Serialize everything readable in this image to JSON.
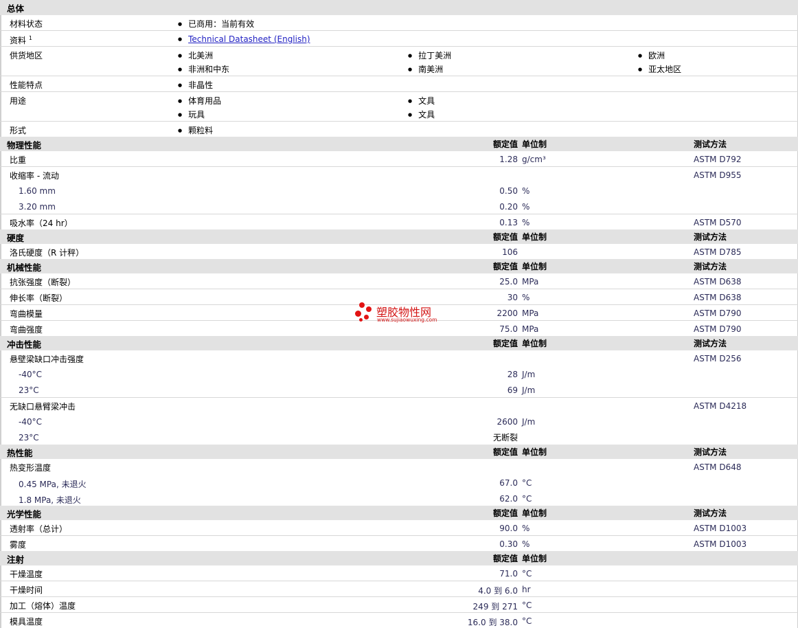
{
  "general": {
    "title": "总体",
    "status_label": "材料状态",
    "status_value": "已商用：当前有效",
    "docs_label": "资料",
    "docs_sup": "1",
    "docs_link": "Technical Datasheet (English)",
    "regions_label": "供货地区",
    "regions": [
      "北美洲",
      "拉丁美洲",
      "欧洲",
      "非洲和中东",
      "南美洲",
      "亚太地区"
    ],
    "features_label": "性能特点",
    "features": [
      "非晶性"
    ],
    "uses_label": "用途",
    "uses": [
      "体育用品",
      "文具",
      "玩具",
      "文具"
    ],
    "form_label": "形式",
    "forms": [
      "颗粒料"
    ]
  },
  "headers": {
    "nominal": "额定值",
    "unit": "单位制",
    "test": "测试方法"
  },
  "physical": {
    "title": "物理性能",
    "sg_label": "比重",
    "sg_value": "1.28",
    "sg_unit": "g/cm³",
    "sg_test": "ASTM D792",
    "shrink_label": "收缩率  - 流动",
    "shrink_test": "ASTM D955",
    "shrink1_label": "1.60 mm",
    "shrink1_value": "0.50",
    "shrink1_unit": "%",
    "shrink2_label": "3.20 mm",
    "shrink2_value": "0.20",
    "shrink2_unit": "%",
    "water_label": "吸水率（24 hr）",
    "water_value": "0.13",
    "water_unit": "%",
    "water_test": "ASTM D570"
  },
  "hardness": {
    "title": "硬度",
    "rockwell_label": "洛氏硬度（R 计秤）",
    "rockwell_value": "106",
    "rockwell_test": "ASTM D785"
  },
  "mechanical": {
    "title": "机械性能",
    "tensile_label": "抗张强度（断裂）",
    "tensile_value": "25.0",
    "tensile_unit": "MPa",
    "tensile_test": "ASTM D638",
    "elong_label": "伸长率（断裂）",
    "elong_value": "30",
    "elong_unit": "%",
    "elong_test": "ASTM D638",
    "flexmod_label": "弯曲模量",
    "flexmod_value": "2200",
    "flexmod_unit": "MPa",
    "flexmod_test": "ASTM D790",
    "flexstr_label": "弯曲强度",
    "flexstr_value": "75.0",
    "flexstr_unit": "MPa",
    "flexstr_test": "ASTM D790"
  },
  "impact": {
    "title": "冲击性能",
    "izod_label": "悬壁梁缺口冲击强度",
    "izod_test": "ASTM D256",
    "izod1_label": "-40°C",
    "izod1_value": "28",
    "izod1_unit": "J/m",
    "izod2_label": "23°C",
    "izod2_value": "69",
    "izod2_unit": "J/m",
    "unnotched_label": "无缺口悬臂梁冲击",
    "unnotched_test": "ASTM D4218",
    "un1_label": "-40°C",
    "un1_value": "2600",
    "un1_unit": "J/m",
    "un2_label": "23°C",
    "un2_value": "无断裂"
  },
  "thermal": {
    "title": "热性能",
    "hdt_label": "热变形温度",
    "hdt_test": "ASTM D648",
    "hdt1_label": "0.45 MPa, 未退火",
    "hdt1_value": "67.0",
    "hdt1_unit": "°C",
    "hdt2_label": "1.8 MPa, 未退火",
    "hdt2_value": "62.0",
    "hdt2_unit": "°C"
  },
  "optical": {
    "title": "光学性能",
    "trans_label": "透射率（总计）",
    "trans_value": "90.0",
    "trans_unit": "%",
    "trans_test": "ASTM D1003",
    "haze_label": "雾度",
    "haze_value": "0.30",
    "haze_unit": "%",
    "haze_test": "ASTM D1003"
  },
  "injection": {
    "title": "注射",
    "dry_temp_label": "干燥温度",
    "dry_temp_value": "71.0",
    "dry_temp_unit": "°C",
    "dry_time_label": "干燥时间",
    "dry_time_value": "4.0 到  6.0",
    "dry_time_unit": "hr",
    "melt_label": "加工（熔体）温度",
    "melt_value": "249 到  271",
    "melt_unit": "°C",
    "mold_label": "模具温度",
    "mold_value": "16.0 到  38.0",
    "mold_unit": "°C"
  },
  "watermark": {
    "name": "塑胶物性网",
    "url": "www.sujiaowuxing.com",
    "color": "#e21414"
  }
}
